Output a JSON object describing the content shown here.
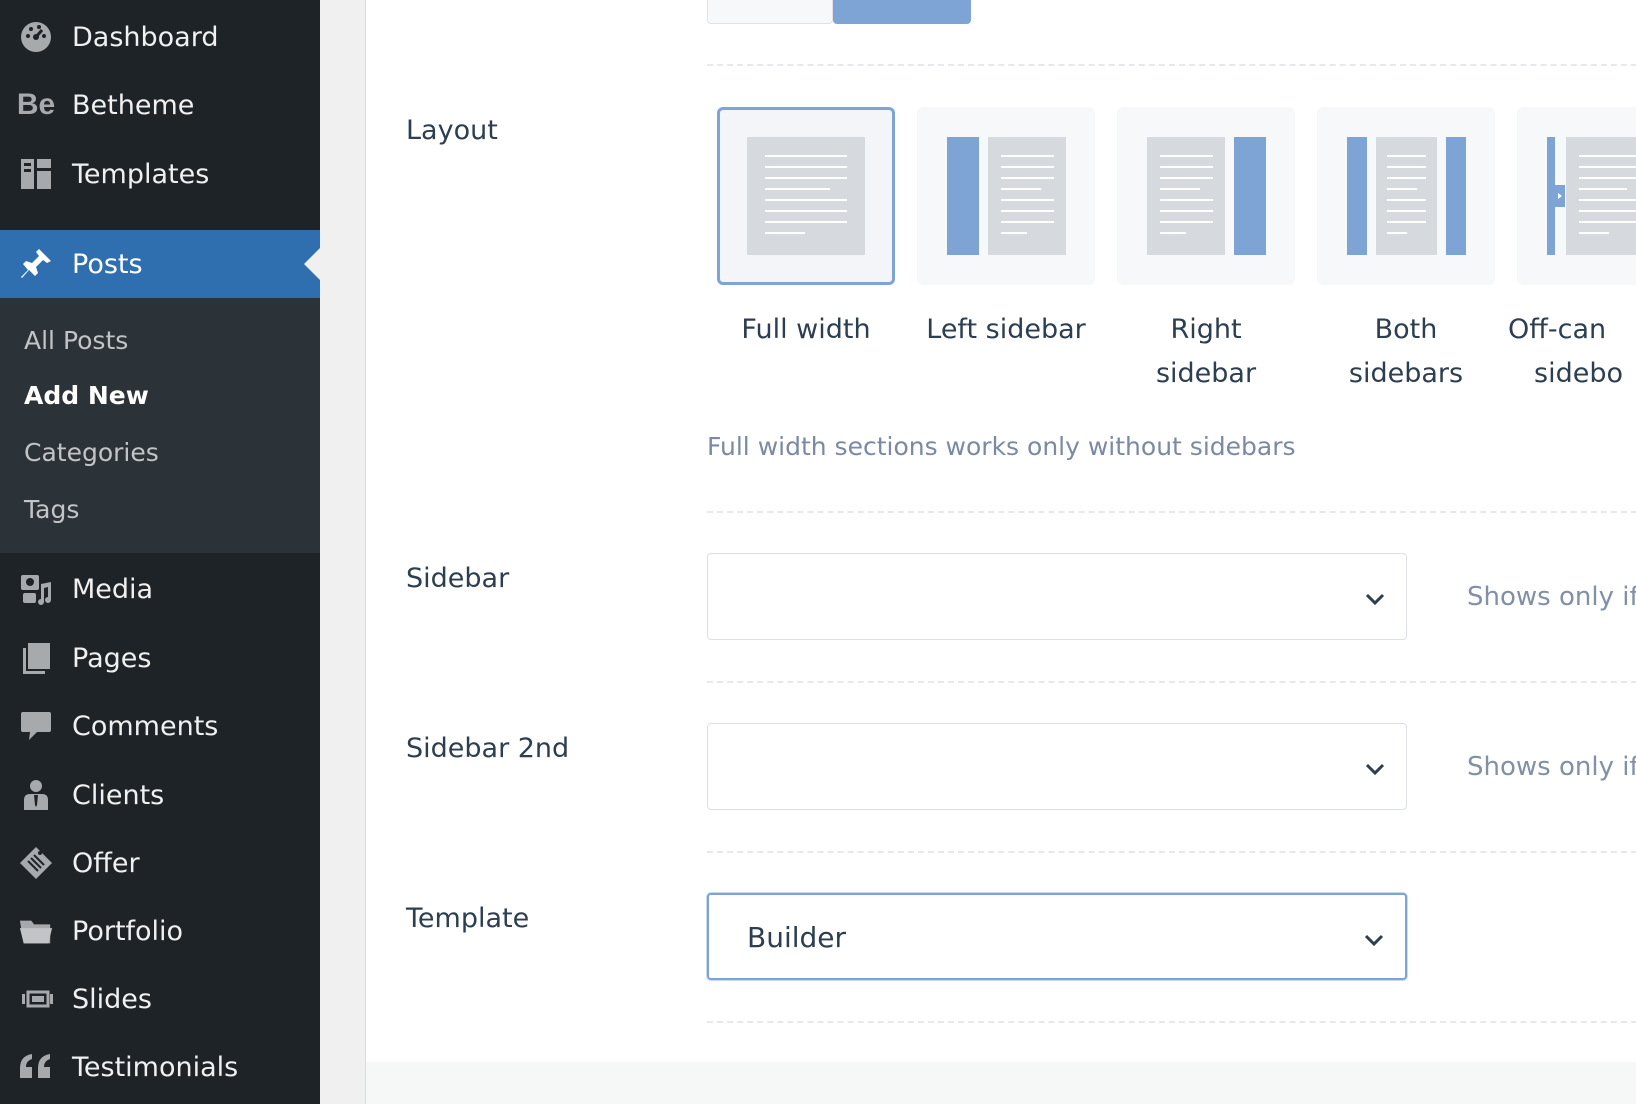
{
  "sidebar": {
    "items": [
      {
        "label": "Dashboard",
        "icon": "dashboard-icon"
      },
      {
        "label": "Betheme",
        "icon": "betheme-icon",
        "glyph": "Be"
      },
      {
        "label": "Templates",
        "icon": "templates-icon"
      },
      {
        "label": "Posts",
        "icon": "pin-icon"
      },
      {
        "label": "Media",
        "icon": "media-icon"
      },
      {
        "label": "Pages",
        "icon": "pages-icon"
      },
      {
        "label": "Comments",
        "icon": "comment-icon"
      },
      {
        "label": "Clients",
        "icon": "clients-icon"
      },
      {
        "label": "Offer",
        "icon": "offer-icon"
      },
      {
        "label": "Portfolio",
        "icon": "folder-icon"
      },
      {
        "label": "Slides",
        "icon": "slides-icon"
      },
      {
        "label": "Testimonials",
        "icon": "quote-icon",
        "glyph": "66"
      }
    ],
    "submenu": [
      "All Posts",
      "Add New",
      "Categories",
      "Tags"
    ],
    "current_item": "Posts",
    "current_subitem": "Add New",
    "accent_color": "#2f6fb0"
  },
  "layout": {
    "label": "Layout",
    "options": [
      {
        "name": "Full width",
        "line2": "",
        "selected": true
      },
      {
        "name": "Left sidebar",
        "line2": "",
        "selected": false
      },
      {
        "name": "Right",
        "line2": "sidebar",
        "selected": false
      },
      {
        "name": "Both",
        "line2": "sidebars",
        "selected": false
      },
      {
        "name": "Off-can",
        "line2": "sidebo",
        "selected": false
      }
    ],
    "hint": "Full width sections works only without sidebars"
  },
  "sidebar_field": {
    "label": "Sidebar",
    "value": "",
    "note": "Shows only if"
  },
  "sidebar2_field": {
    "label": "Sidebar 2nd",
    "value": "",
    "note": "Shows only if"
  },
  "template_field": {
    "label": "Template",
    "value": "Builder"
  }
}
